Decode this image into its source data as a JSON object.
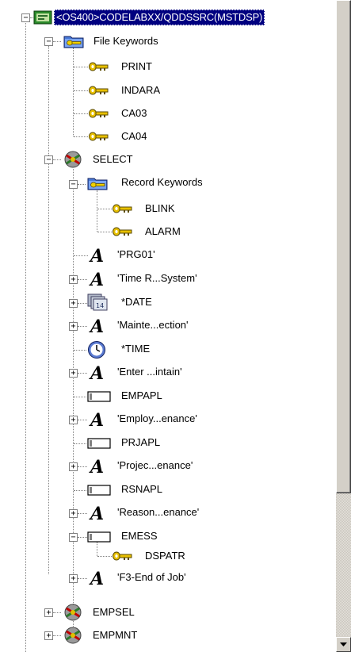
{
  "tree": {
    "root": {
      "label": "<OS400>CODELABXX/QDDSSRC(MSTDSP)",
      "icon": "file-member-icon"
    },
    "file_keywords": {
      "label": "File Keywords",
      "icon": "keyword-folder-icon",
      "items": [
        {
          "label": "PRINT",
          "icon": "key-icon"
        },
        {
          "label": "INDARA",
          "icon": "key-icon"
        },
        {
          "label": "CA03",
          "icon": "key-icon"
        },
        {
          "label": "CA04",
          "icon": "key-icon"
        }
      ]
    },
    "select": {
      "label": "SELECT",
      "icon": "record-format-icon",
      "record_keywords": {
        "label": "Record Keywords",
        "icon": "keyword-folder-icon",
        "items": [
          {
            "label": "BLINK",
            "icon": "key-icon"
          },
          {
            "label": "ALARM",
            "icon": "key-icon"
          }
        ]
      },
      "fields": [
        {
          "label": "'PRG01'",
          "icon": "constant-text-icon"
        },
        {
          "label": "'Time R...System'",
          "icon": "constant-text-icon"
        },
        {
          "label": "*DATE",
          "icon": "calendar-icon"
        },
        {
          "label": "'Mainte...ection'",
          "icon": "constant-text-icon"
        },
        {
          "label": "*TIME",
          "icon": "clock-icon"
        },
        {
          "label": "'Enter ...intain'",
          "icon": "constant-text-icon"
        },
        {
          "label": "EMPAPL",
          "icon": "field-icon"
        },
        {
          "label": "'Employ...enance'",
          "icon": "constant-text-icon"
        },
        {
          "label": "PRJAPL",
          "icon": "field-icon"
        },
        {
          "label": "'Projec...enance'",
          "icon": "constant-text-icon"
        },
        {
          "label": "RSNAPL",
          "icon": "field-icon"
        },
        {
          "label": "'Reason...enance'",
          "icon": "constant-text-icon"
        },
        {
          "label": "EMESS",
          "icon": "field-icon"
        },
        {
          "label": "DSPATR",
          "icon": "key-icon"
        },
        {
          "label": "'F3-End of Job'",
          "icon": "constant-text-icon"
        }
      ]
    },
    "records": [
      {
        "label": "EMPSEL",
        "icon": "record-format-icon"
      },
      {
        "label": "EMPMNT",
        "icon": "record-format-icon"
      }
    ]
  },
  "colors": {
    "selection": "#000080",
    "key": "#c8a000",
    "folder": "#3366cc"
  }
}
